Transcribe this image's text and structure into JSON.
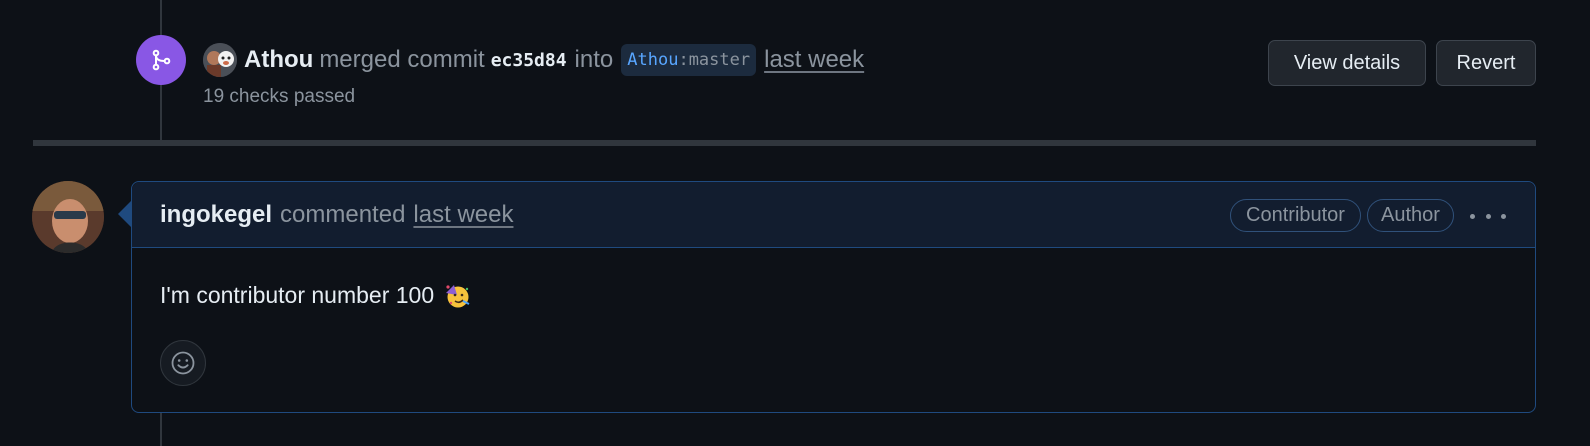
{
  "merge_event": {
    "actor": "Athou",
    "verb": "merged commit",
    "commit_sha": "ec35d84",
    "into_text": "into",
    "branch_owner": "Athou",
    "branch_separator": ":",
    "branch_name": "master",
    "time": "last week",
    "checks": "19 checks passed",
    "view_details_label": "View details",
    "revert_label": "Revert",
    "badge_icon": "git-merge-icon",
    "badge_color": "#8957e5"
  },
  "comment": {
    "author": "ingokegel",
    "verb": "commented",
    "time": "last week",
    "badges": [
      "Contributor",
      "Author"
    ],
    "body": "I'm contributor number 100",
    "body_emoji": "partying-face-icon",
    "menu_icon": "kebab-horizontal-icon",
    "reaction_icon": "smiley-icon",
    "border_color": "#1f4a7f",
    "header_bg": "#121d2f"
  },
  "colors": {
    "background": "#0d1117",
    "text_primary": "#e6edf3",
    "text_muted": "#8b949e",
    "link_blue": "#58a6ff"
  }
}
